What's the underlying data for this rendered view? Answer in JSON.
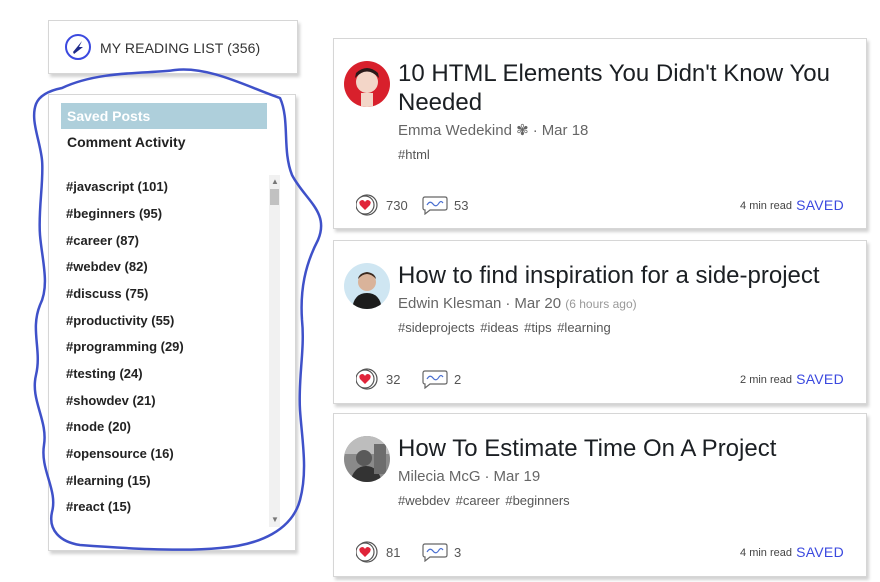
{
  "header": {
    "title": "MY READING LIST (356)"
  },
  "nav": {
    "saved": "Saved Posts",
    "comments": "Comment Activity"
  },
  "tags": [
    "#javascript (101)",
    "#beginners (95)",
    "#career (87)",
    "#webdev (82)",
    "#discuss (75)",
    "#productivity (55)",
    "#programming (29)",
    "#testing (24)",
    "#showdev (21)",
    "#node (20)",
    "#opensource (16)",
    "#learning (15)",
    "#react (15)"
  ],
  "posts": [
    {
      "title": "10 HTML Elements You Didn't Know You Needed",
      "author": "Emma Wedekind",
      "date": "Mar 18",
      "ago": "",
      "tags": "#html",
      "reactions": "730",
      "comments": "53",
      "read_time": "4 min read",
      "saved": "SAVED"
    },
    {
      "title": "How to find inspiration for a side-project",
      "author": "Edwin Klesman",
      "date": "Mar 20",
      "ago": "(6 hours ago)",
      "tags": "#sideprojects #ideas #tips #learning",
      "reactions": "32",
      "comments": "2",
      "read_time": "2 min read",
      "saved": "SAVED"
    },
    {
      "title": "How To Estimate Time On A Project",
      "author": "Milecia McG",
      "date": "Mar 19",
      "ago": "",
      "tags": "#webdev #career #beginners",
      "reactions": "81",
      "comments": "3",
      "read_time": "4 min read",
      "saved": "SAVED"
    }
  ],
  "colors": {
    "accent": "#3b49df",
    "saved_nav": "#aecfdb",
    "scribble": "#3f51c9",
    "heart": "#e0243a"
  }
}
